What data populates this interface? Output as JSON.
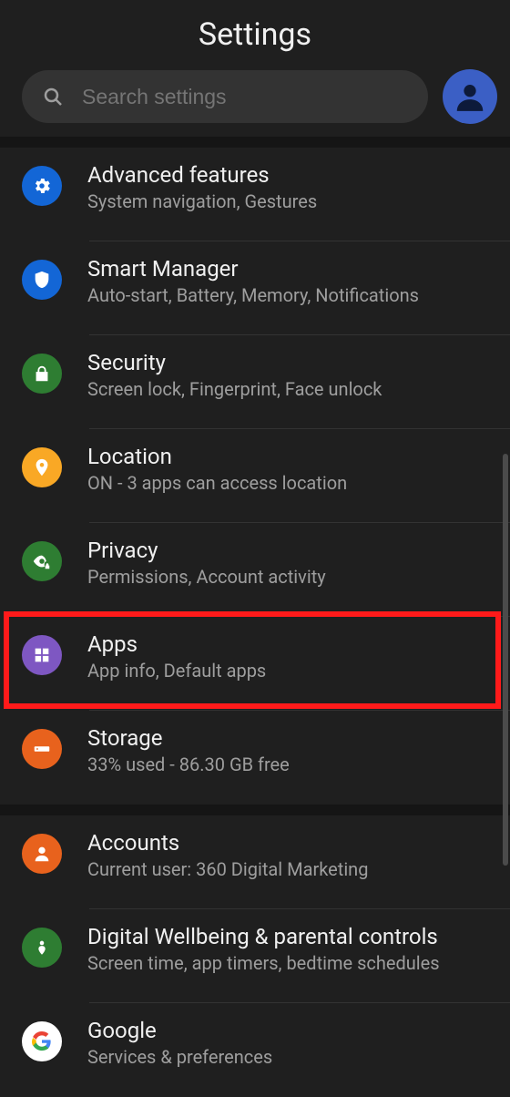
{
  "header": {
    "title": "Settings"
  },
  "search": {
    "placeholder": "Search settings"
  },
  "items": [
    {
      "id": "advanced",
      "title": "Advanced features",
      "sub": "System navigation, Gestures"
    },
    {
      "id": "smart",
      "title": "Smart Manager",
      "sub": "Auto-start, Battery, Memory, Notifications"
    },
    {
      "id": "security",
      "title": "Security",
      "sub": "Screen lock, Fingerprint, Face unlock"
    },
    {
      "id": "location",
      "title": "Location",
      "sub": "ON - 3 apps can access location"
    },
    {
      "id": "privacy",
      "title": "Privacy",
      "sub": "Permissions, Account activity"
    },
    {
      "id": "apps",
      "title": "Apps",
      "sub": "App info, Default apps"
    },
    {
      "id": "storage",
      "title": "Storage",
      "sub": "33% used - 86.30 GB free"
    },
    {
      "id": "accounts",
      "title": "Accounts",
      "sub": "Current user: 360 Digital Marketing"
    },
    {
      "id": "wellbeing",
      "title": "Digital Wellbeing & parental controls",
      "sub": "Screen time, app timers, bedtime schedules"
    },
    {
      "id": "google",
      "title": "Google",
      "sub": "Services & preferences"
    }
  ],
  "highlight": {
    "item_id": "apps"
  }
}
